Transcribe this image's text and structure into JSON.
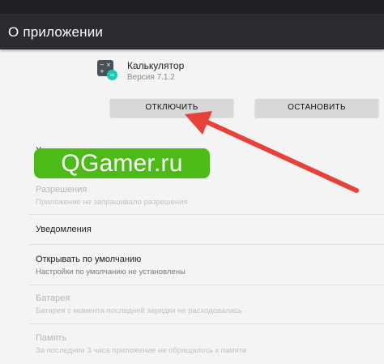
{
  "toolbar": {
    "title": "О приложении"
  },
  "app": {
    "name": "Калькулятор",
    "version": "Версия 7.1.2",
    "icon": "calculator-icon"
  },
  "buttons": {
    "disable_label": "ОТКЛЮЧИТЬ",
    "stop_label": "ОСТАНОВИТЬ"
  },
  "settings": {
    "storage_partial": "Х",
    "permissions_title": "Разрешения",
    "permissions_sub": "Приложение не запрашивало разрешения",
    "notifications_title": "Уведомления",
    "default_title": "Открывать по умолчанию",
    "default_sub": "Настройки по умолчанию не установлены",
    "battery_title": "Батарея",
    "battery_sub": "Батарея с момента последней зарядки не расходовалась",
    "memory_title": "Память",
    "memory_sub": "За последние 3 часа приложение не обращалось к памяти"
  },
  "watermark": {
    "text": "QGamer.ru"
  },
  "colors": {
    "toolbar": "#2a2c30",
    "watermark": "#4cbb17",
    "arrow": "#e8413a",
    "app_badge": "#1ec8b4"
  }
}
